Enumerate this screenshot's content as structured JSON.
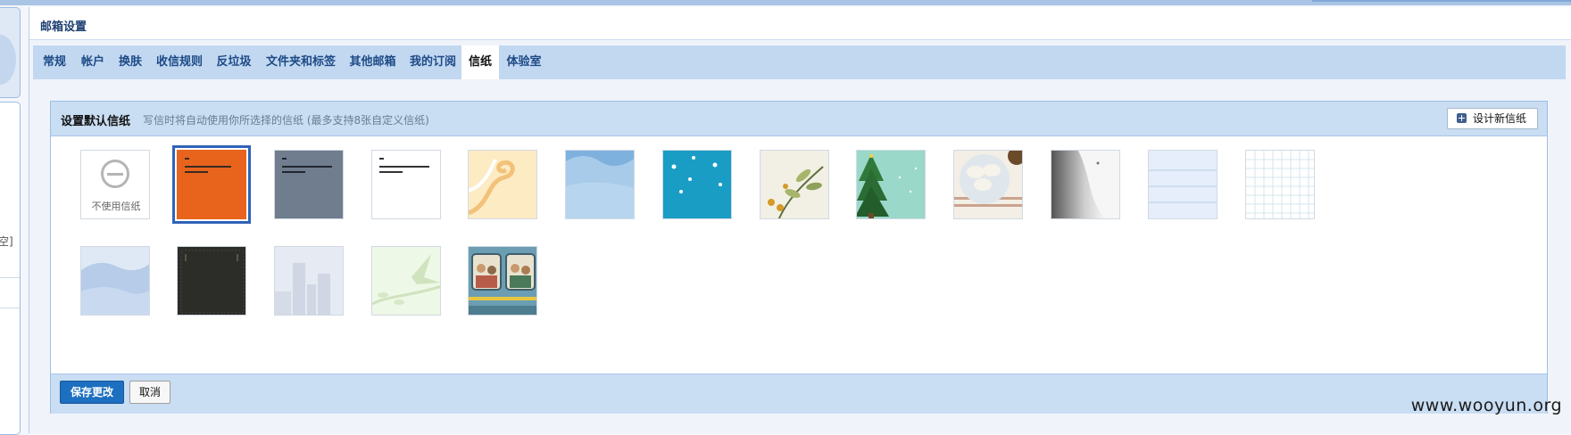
{
  "left_rail": {
    "fragment_text": "空]"
  },
  "header": {
    "title": "邮箱设置"
  },
  "tabs": [
    {
      "label": "常规"
    },
    {
      "label": "帐户"
    },
    {
      "label": "换肤"
    },
    {
      "label": "收信规则"
    },
    {
      "label": "反垃圾"
    },
    {
      "label": "文件夹和标签"
    },
    {
      "label": "其他邮箱"
    },
    {
      "label": "我的订阅"
    },
    {
      "label": "信纸",
      "active": true
    },
    {
      "label": "体验室"
    }
  ],
  "section": {
    "title": "设置默认信纸",
    "subtitle": "写信时将自动使用你所选择的信纸 (最多支持8张自定义信纸)",
    "design_button": "设计新信纸",
    "design_icon": "plus-square-icon"
  },
  "stationery": {
    "no_stationery_label": "不使用信纸",
    "selected_index": 1,
    "items": [
      {
        "name": "none",
        "icon": "no-entry-icon"
      },
      {
        "name": "orange-custom",
        "color": "#e8641c"
      },
      {
        "name": "slate-custom",
        "color": "#6f7d8e"
      },
      {
        "name": "white-custom",
        "color": "#ffffff"
      },
      {
        "name": "cream-swirl",
        "color": "#fdebc4"
      },
      {
        "name": "sky-clouds",
        "color": "#a8cbea"
      },
      {
        "name": "teal-snow",
        "color": "#1a9dc4"
      },
      {
        "name": "olive-branch",
        "color": "#f2f0e4"
      },
      {
        "name": "christmas-tree",
        "color": "#9ad8ca"
      },
      {
        "name": "dumplings",
        "color": "#f3efe6"
      },
      {
        "name": "grey-fur",
        "color": "#eeeeee"
      },
      {
        "name": "blue-lines",
        "color": "#e5eefa"
      },
      {
        "name": "grid-paper",
        "color": "#ffffff"
      },
      {
        "name": "blue-mountains",
        "color": "#c9daf0"
      },
      {
        "name": "dark-leather",
        "color": "#2c2c28"
      },
      {
        "name": "city-skyline",
        "color": "#e6eaf3"
      },
      {
        "name": "green-bird",
        "color": "#eef8e6"
      },
      {
        "name": "tram-passengers",
        "color": "#6b9eb3"
      }
    ]
  },
  "footer": {
    "save_label": "保存更改",
    "cancel_label": "取消"
  },
  "watermark": "www.wooyun.org",
  "colors": {
    "accent": "#1d6fc0",
    "tab_bar": "#c2d8f1",
    "header_bar": "#c9ddf3",
    "selected_outline": "#2f63b8"
  }
}
